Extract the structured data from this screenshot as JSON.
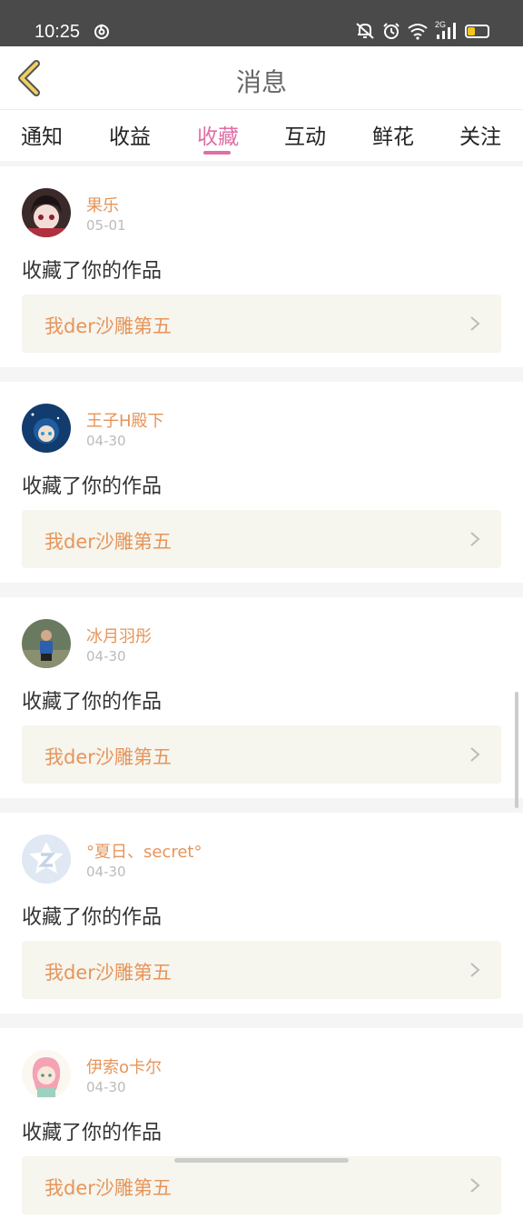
{
  "status": {
    "time": "10:25",
    "icons": [
      "netease-music-icon",
      "mute-icon",
      "alarm-icon",
      "wifi-icon",
      "signal-2g-icon",
      "battery-icon"
    ],
    "network": "2G"
  },
  "header": {
    "title": "消息",
    "back_icon": "chevron-left-icon"
  },
  "tabs": [
    {
      "label": "通知",
      "active": false
    },
    {
      "label": "收益",
      "active": false
    },
    {
      "label": "收藏",
      "active": true
    },
    {
      "label": "互动",
      "active": false
    },
    {
      "label": "鲜花",
      "active": false
    },
    {
      "label": "关注",
      "active": false
    }
  ],
  "items": [
    {
      "name": "果乐",
      "date": "05-01",
      "message": "收藏了你的作品",
      "work": "我der沙雕第五"
    },
    {
      "name": "王子H殿下",
      "date": "04-30",
      "message": "收藏了你的作品",
      "work": "我der沙雕第五"
    },
    {
      "name": "冰月羽彤",
      "date": "04-30",
      "message": "收藏了你的作品",
      "work": "我der沙雕第五"
    },
    {
      "name": "°夏日、secret°",
      "date": "04-30",
      "message": "收藏了你的作品",
      "work": "我der沙雕第五"
    },
    {
      "name": "伊索o卡尔",
      "date": "04-30",
      "message": "收藏了你的作品",
      "work": "我der沙雕第五"
    }
  ],
  "colors": {
    "accent": "#e06fa4",
    "name": "#e6955a",
    "work_bg": "#f6f5ee",
    "status_bg": "#4a4a4a"
  }
}
